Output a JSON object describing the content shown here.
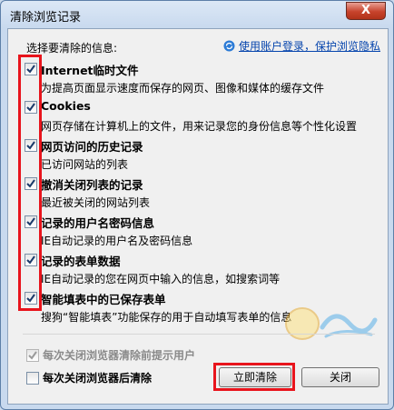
{
  "window": {
    "title": "清除浏览记录",
    "close_label": "X"
  },
  "prompt": "选择要清除的信息:",
  "privacy_link": "使用账户登录，保护浏览隐私",
  "items": [
    {
      "title": "Internet临时文件",
      "desc": "为提高页面显示速度而保存的网页、图像和媒体的缓存文件",
      "checked": true
    },
    {
      "title": "Cookies",
      "desc": "网页存储在计算机上的文件，用来记录您的身份信息等个性化设置",
      "checked": true
    },
    {
      "title": "网页访问的历史记录",
      "desc": "已访问网站的列表",
      "checked": true
    },
    {
      "title": "撤消关闭列表的记录",
      "desc": "最近被关闭的网站列表",
      "checked": true
    },
    {
      "title": "记录的用户名密码信息",
      "desc": "IE自动记录的用户名及密码信息",
      "checked": true
    },
    {
      "title": "记录的表单数据",
      "desc": "IE自动记录的您在网页中输入的信息，如搜索词等",
      "checked": true
    },
    {
      "title": "智能填表中的已保存表单",
      "desc": "搜狗“智能填表”功能保存的用于自动填写表单的信息",
      "checked": true
    }
  ],
  "bottom": {
    "protect_user_label": "每次关闭浏览器清除前提示用户",
    "clear_on_close_label": "每次关闭浏览器后清除"
  },
  "buttons": {
    "clear_now": "立即清除",
    "close": "关闭"
  },
  "colors": {
    "highlight": "#e8141c",
    "link": "#0645ad"
  }
}
